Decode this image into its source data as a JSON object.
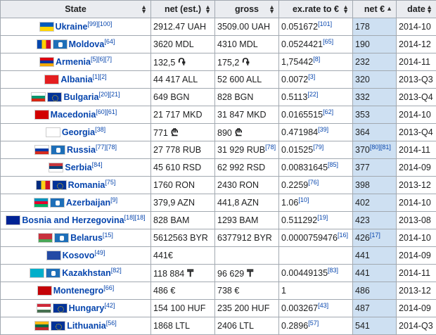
{
  "headers": [
    {
      "label": "State",
      "sort": "both"
    },
    {
      "label": "net (est.)",
      "sort": "both"
    },
    {
      "label": "gross",
      "sort": "both"
    },
    {
      "label": "ex.rate to €",
      "sort": "both"
    },
    {
      "label": "net €",
      "sort": "asc"
    },
    {
      "label": "date",
      "sort": "both"
    }
  ],
  "rows": [
    {
      "state": "Ukraine",
      "ref": "[99][100]",
      "flags": [
        {
          "type": "stripes",
          "colors": [
            "#005bbb",
            "#ffd500"
          ]
        }
      ],
      "net": "2912.47 UAH",
      "gross": "3509.00 UAH",
      "rate": "0.051672",
      "rate_ref": "[101]",
      "neteur": "178",
      "neteur_ref": "",
      "date": "2014-10"
    },
    {
      "state": "Moldova",
      "ref": "[64]",
      "flags": [
        {
          "type": "vstripes",
          "colors": [
            "#0046ae",
            "#ffd200",
            "#cc092f"
          ]
        },
        {
          "type": "cis"
        }
      ],
      "net": "3620 MDL",
      "gross": "4310 MDL",
      "rate": "0.0524421",
      "rate_ref": "[65]",
      "neteur": "190",
      "neteur_ref": "",
      "date": "2014-12"
    },
    {
      "state": "Armenia",
      "ref": "[5][6][7]",
      "flags": [
        {
          "type": "stripes",
          "colors": [
            "#d90012",
            "#0033a0",
            "#f2a800"
          ]
        }
      ],
      "net": "132,5",
      "net_sym": "֏",
      "gross": "175,2",
      "gross_sym": "֏",
      "rate": "1,75442",
      "rate_ref": "[8]",
      "neteur": "232",
      "neteur_ref": "",
      "date": "2014-11"
    },
    {
      "state": "Albania",
      "ref": "[1][2]",
      "flags": [
        {
          "type": "solid",
          "colors": [
            "#e41e20"
          ]
        }
      ],
      "net": "44 417 ALL",
      "gross": "52 600 ALL",
      "rate": "0.0072",
      "rate_ref": "[3]",
      "neteur": "320",
      "neteur_ref": "",
      "date": "2013-Q3"
    },
    {
      "state": "Bulgaria",
      "ref": "[20][21]",
      "flags": [
        {
          "type": "stripes",
          "colors": [
            "#ffffff",
            "#00966e",
            "#d62612"
          ]
        },
        {
          "type": "eu"
        }
      ],
      "net": "649 BGN",
      "gross": "828 BGN",
      "rate": "0.5113",
      "rate_ref": "[22]",
      "neteur": "332",
      "neteur_ref": "",
      "date": "2013-Q4"
    },
    {
      "state": "Macedonia",
      "ref": "[60][61]",
      "flags": [
        {
          "type": "solid",
          "colors": [
            "#d20000"
          ]
        }
      ],
      "net": "21 717 MKD",
      "gross": "31 847 MKD",
      "rate": "0.0165515",
      "rate_ref": "[62]",
      "neteur": "353",
      "neteur_ref": "",
      "date": "2014-10"
    },
    {
      "state": "Georgia",
      "ref": "[38]",
      "flags": [
        {
          "type": "solid",
          "colors": [
            "#ffffff"
          ]
        }
      ],
      "net": "771",
      "net_sym": "₾",
      "gross": "890",
      "gross_sym": "₾",
      "rate": "0.471984",
      "rate_ref": "[39]",
      "neteur": "364",
      "neteur_ref": "",
      "date": "2013-Q4"
    },
    {
      "state": "Russia",
      "ref": "[77][78]",
      "flags": [
        {
          "type": "stripes",
          "colors": [
            "#ffffff",
            "#0039a6",
            "#d52b1e"
          ]
        },
        {
          "type": "cis"
        }
      ],
      "net": "27 778 RUB",
      "gross": "31 929 RUB",
      "gross_ref": "[78]",
      "rate": "0.01525",
      "rate_ref": "[79]",
      "neteur": "370",
      "neteur_ref": "[80][81]",
      "date": "2014-11"
    },
    {
      "state": "Serbia",
      "ref": "[84]",
      "flags": [
        {
          "type": "stripes",
          "colors": [
            "#c6363c",
            "#0c4076",
            "#ffffff"
          ]
        }
      ],
      "net": "45 610 RSD",
      "gross": "62 992 RSD",
      "rate": "0.00831645",
      "rate_ref": "[85]",
      "neteur": "377",
      "neteur_ref": "",
      "date": "2014-09"
    },
    {
      "state": "Romania",
      "ref": "[75]",
      "flags": [
        {
          "type": "vstripes",
          "colors": [
            "#002b7f",
            "#fcd116",
            "#ce1126"
          ]
        },
        {
          "type": "eu"
        }
      ],
      "net": "1760 RON",
      "gross": "2430 RON",
      "rate": "0.2259",
      "rate_ref": "[76]",
      "neteur": "398",
      "neteur_ref": "",
      "date": "2013-12"
    },
    {
      "state": "Azerbaijan",
      "ref": "[9]",
      "flags": [
        {
          "type": "stripes",
          "colors": [
            "#0092bc",
            "#e4002b",
            "#00af66"
          ]
        },
        {
          "type": "cis"
        }
      ],
      "net": "379,9 AZN",
      "gross": "441,8 AZN",
      "rate": "1.06",
      "rate_ref": "[10]",
      "neteur": "402",
      "neteur_ref": "",
      "date": "2014-10"
    },
    {
      "state": "Bosnia and Herzegovina",
      "ref": "[18][18]",
      "flags": [
        {
          "type": "solid",
          "colors": [
            "#002395"
          ]
        }
      ],
      "net": "828 BAM",
      "gross": "1293 BAM",
      "rate": "0.511292",
      "rate_ref": "[19]",
      "neteur": "423",
      "neteur_ref": "",
      "date": "2013-08"
    },
    {
      "state": "Belarus",
      "ref": "[15]",
      "flags": [
        {
          "type": "stripes",
          "colors": [
            "#c8313e",
            "#c8313e",
            "#4aa657"
          ]
        },
        {
          "type": "cis"
        }
      ],
      "net": "5612563 BYR",
      "gross": "6377912 BYR",
      "rate": "0.0000759476",
      "rate_ref": "[16]",
      "neteur": "426",
      "neteur_ref": "[17]",
      "date": "2014-10"
    },
    {
      "state": "Kosovo",
      "ref": "[49]",
      "flags": [
        {
          "type": "solid",
          "colors": [
            "#244aa5"
          ]
        }
      ],
      "net": "441€",
      "gross": "",
      "rate": "",
      "rate_ref": "",
      "neteur": "441",
      "neteur_ref": "",
      "date": "2014-09"
    },
    {
      "state": "Kazakhstan",
      "ref": "[82]",
      "flags": [
        {
          "type": "solid",
          "colors": [
            "#00afca"
          ]
        },
        {
          "type": "cis"
        }
      ],
      "net": "118 884",
      "net_sym": "₸",
      "gross": "96 629",
      "gross_sym": "₸",
      "rate": "0.00449135",
      "rate_ref": "[83]",
      "neteur": "441",
      "neteur_ref": "",
      "date": "2014-11"
    },
    {
      "state": "Montenegro",
      "ref": "[66]",
      "flags": [
        {
          "type": "solid",
          "colors": [
            "#c40308"
          ]
        }
      ],
      "net": "486 €",
      "gross": "738 €",
      "rate": "1",
      "rate_ref": "",
      "neteur": "486",
      "neteur_ref": "",
      "date": "2013-12"
    },
    {
      "state": "Hungary",
      "ref": "[42]",
      "flags": [
        {
          "type": "stripes",
          "colors": [
            "#ce2939",
            "#ffffff",
            "#477050"
          ]
        },
        {
          "type": "eu"
        }
      ],
      "net": "154 100 HUF",
      "gross": "235 200 HUF",
      "rate": "0.003267",
      "rate_ref": "[43]",
      "neteur": "487",
      "neteur_ref": "",
      "date": "2014-09"
    },
    {
      "state": "Lithuania",
      "ref": "[56]",
      "flags": [
        {
          "type": "stripes",
          "colors": [
            "#fdb913",
            "#006a44",
            "#c1272d"
          ]
        },
        {
          "type": "eu"
        }
      ],
      "net": "1868 LTL",
      "gross": "2406 LTL",
      "rate": "0.2896",
      "rate_ref": "[57]",
      "neteur": "541",
      "neteur_ref": "",
      "date": "2014-Q3"
    }
  ]
}
